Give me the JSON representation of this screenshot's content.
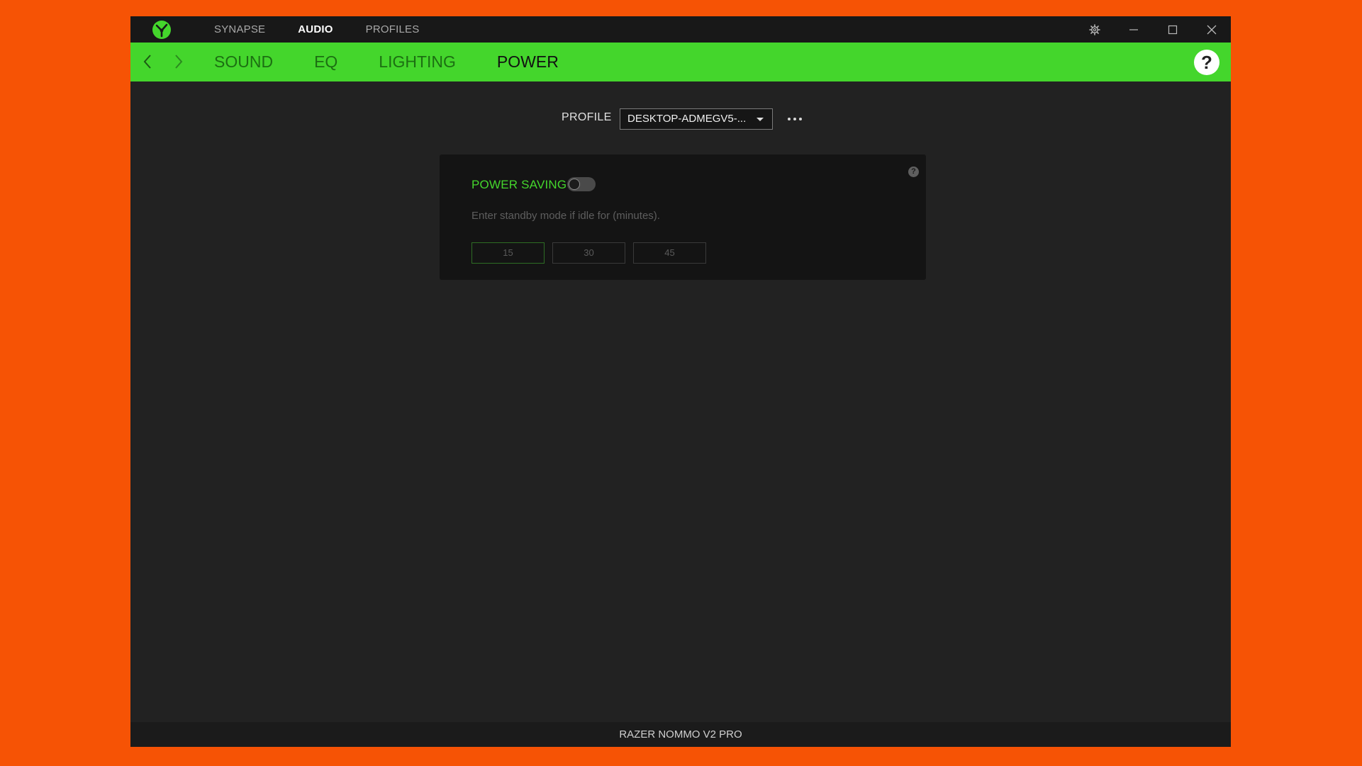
{
  "colors": {
    "background": "#f65305",
    "accent_green": "#44d62c",
    "window_bg": "#222222",
    "titlebar_bg": "#181818",
    "card_bg": "#141414"
  },
  "titlebar": {
    "logo_icon": "razer-snake-logo",
    "nav": [
      {
        "label": "SYNAPSE",
        "active": false
      },
      {
        "label": "AUDIO",
        "active": true
      },
      {
        "label": "PROFILES",
        "active": false
      }
    ],
    "controls": [
      "settings-icon",
      "minimize-icon",
      "maximize-icon",
      "close-icon"
    ]
  },
  "subnav": {
    "back_icon": "chevron-left-icon",
    "forward_icon": "chevron-right-icon",
    "tabs": [
      {
        "label": "SOUND",
        "active": false
      },
      {
        "label": "EQ",
        "active": false
      },
      {
        "label": "LIGHTING",
        "active": false
      },
      {
        "label": "POWER",
        "active": true
      }
    ],
    "help_label": "?"
  },
  "profile": {
    "label": "PROFILE",
    "selected": "DESKTOP-ADMEGV5-...",
    "more_icon": "ellipsis-icon"
  },
  "power_card": {
    "title": "POWER SAVING",
    "toggle_on": false,
    "description": "Enter standby mode if idle for (minutes).",
    "help_label": "?",
    "options": [
      {
        "label": "15",
        "selected": true
      },
      {
        "label": "30",
        "selected": false
      },
      {
        "label": "45",
        "selected": false
      }
    ]
  },
  "footer": {
    "device_name": "RAZER NOMMO V2 PRO"
  }
}
